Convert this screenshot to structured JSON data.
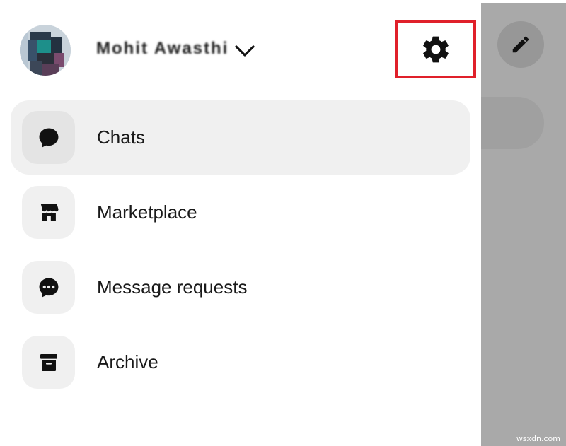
{
  "header": {
    "username": "Mohit Awasthi",
    "account_switch_icon": "chevron-down-icon",
    "settings_icon": "gear-icon",
    "highlight_color": "#e0202a"
  },
  "menu": {
    "items": [
      {
        "label": "Chats",
        "icon": "chat-bubble-icon",
        "active": true
      },
      {
        "label": "Marketplace",
        "icon": "storefront-icon",
        "active": false
      },
      {
        "label": "Message requests",
        "icon": "message-requests-icon",
        "active": false
      },
      {
        "label": "Archive",
        "icon": "archive-icon",
        "active": false
      }
    ]
  },
  "background_panel": {
    "compose_icon": "pencil-icon",
    "watermark": "wsxdn.com"
  },
  "colors": {
    "active_row_bg": "#f0f0f0",
    "overlay_gray": "#a9a9a9",
    "icon_dark": "#111111"
  }
}
